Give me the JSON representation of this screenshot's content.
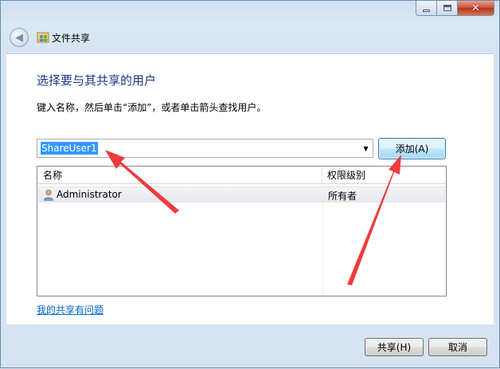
{
  "window": {
    "title": "文件共享"
  },
  "page": {
    "heading": "选择要与其共享的用户",
    "instruction": "键入名称，然后单击“添加”，或者单击箭头查找用户。"
  },
  "user_combo": {
    "value": "ShareUser1"
  },
  "buttons": {
    "add": "添加(A)",
    "share": "共享(H)",
    "cancel": "取消"
  },
  "table": {
    "columns": [
      "名称",
      "权限级别"
    ],
    "rows": [
      {
        "name": "Administrator",
        "permission": "所有者"
      }
    ]
  },
  "help_link": "我的共享有问题",
  "icons": {
    "back": "back-arrow-icon",
    "share": "share-users-icon",
    "user": "user-icon",
    "dropdown": "chevron-down-icon"
  },
  "colors": {
    "heading": "#1e3287",
    "selection": "#3399ff",
    "link": "#0066cc",
    "annotation_arrow": "#ee3b3b"
  }
}
